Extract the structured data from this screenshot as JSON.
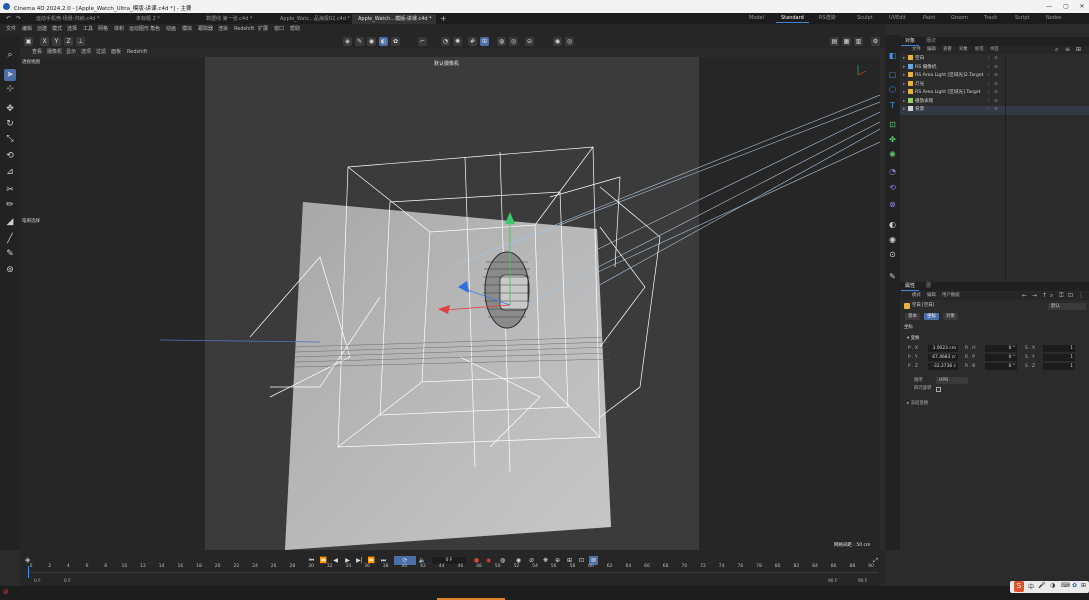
{
  "window": {
    "title": "Cinema 4D 2024.2.0 - [Apple_Watch_Ultra_模版-讲课.c4d *] - 主要",
    "minimize": "—",
    "maximize": "▢",
    "close": "✕"
  },
  "doc_tabs": [
    {
      "label": "运动手机壳-场景-归纳.c4d *",
      "active": false
    },
    {
      "label": "未标题 2 *",
      "active": false
    },
    {
      "label": "数据线 第一张.c4d *",
      "active": false
    },
    {
      "label": "Apple_Watc...品海报02.c4d *",
      "active": false
    },
    {
      "label": "Apple_Watch...模版-讲课.c4d *",
      "active": true
    }
  ],
  "new_tab": "+",
  "layouts": [
    "Model",
    "Standard",
    "RS渲染",
    "Sculpt",
    "UVEdit",
    "Paint",
    "Groom",
    "Track",
    "Script",
    "Nodes"
  ],
  "active_layout": "Standard",
  "menu": [
    "文件",
    "编辑",
    "创建",
    "模式",
    "选择",
    "工具",
    "网格",
    "体积",
    "运动图形",
    "角色",
    "动画",
    "模拟",
    "跟踪器",
    "渲染",
    "Redshift",
    "扩展",
    "窗口",
    "帮助"
  ],
  "viewport": {
    "menu": [
      "查看",
      "摄像机",
      "显示",
      "选项",
      "过滤",
      "面板",
      "Redshift"
    ],
    "title": "透视视图",
    "camera_label": "默认摄像机",
    "grid_info": "网格间距 : 50 cm",
    "hud_label": "笔刷选择"
  },
  "object_panel": {
    "tabs": [
      "对象",
      "场次"
    ],
    "menu": [
      "文件",
      "编辑",
      "查看",
      "对象",
      "标签",
      "书签"
    ],
    "objects": [
      {
        "name": "空白",
        "color": "#e6b43c"
      },
      {
        "name": "RS 摄像机",
        "color": "#6fa8e0"
      },
      {
        "name": "RS Area Light [区域光]2.Target",
        "color": "#e6b43c"
      },
      {
        "name": "灯光",
        "color": "#e6b43c"
      },
      {
        "name": "RS Area Light [区域光].Target",
        "color": "#e6b43c"
      },
      {
        "name": "播放表现",
        "color": "#9acb6b"
      },
      {
        "name": "背景",
        "color": "#d0d0d0"
      }
    ]
  },
  "attr_panel": {
    "tabs": [
      "属性",
      "层"
    ],
    "menu": [
      "模式",
      "编辑",
      "用户数据"
    ],
    "object_name": "空白 [空白]",
    "preset": "默认",
    "subtabs": [
      "基本",
      "坐标",
      "对象"
    ],
    "active_subtab": "坐标",
    "section": "坐标",
    "subsection": "变换",
    "rows": [
      {
        "p_label": "P . X",
        "p": "3.0023 cm",
        "r_label": "R . H",
        "r": "0 °",
        "s_label": "S . X",
        "s": "1"
      },
      {
        "p_label": "P . Y",
        "p": "67.4683 cr",
        "r_label": "R . P",
        "r": "0 °",
        "s_label": "S . Y",
        "s": "1"
      },
      {
        "p_label": "P . Z",
        "p": "-32.2736 c",
        "r_label": "R . B",
        "r": "0 °",
        "s_label": "S . Z",
        "s": "1"
      }
    ],
    "order_label": "顺序",
    "order_value": "HPB",
    "quat_label": "四元旋转",
    "freeze_label": "冻结变换"
  },
  "timeline": {
    "ticks": [
      "0",
      "2",
      "4",
      "6",
      "8",
      "10",
      "12",
      "14",
      "16",
      "18",
      "20",
      "22",
      "24",
      "26",
      "28",
      "30",
      "32",
      "34",
      "36",
      "38",
      "40",
      "42",
      "44",
      "46",
      "48",
      "50",
      "52",
      "54",
      "56",
      "58",
      "60",
      "62",
      "64",
      "66",
      "68",
      "70",
      "72",
      "74",
      "76",
      "78",
      "80",
      "82",
      "84",
      "86",
      "88",
      "90"
    ],
    "current_frame": "0 F",
    "start_left": "0 F",
    "start_right": "0 F",
    "end_left": "90 F",
    "end_right": "90 F"
  }
}
